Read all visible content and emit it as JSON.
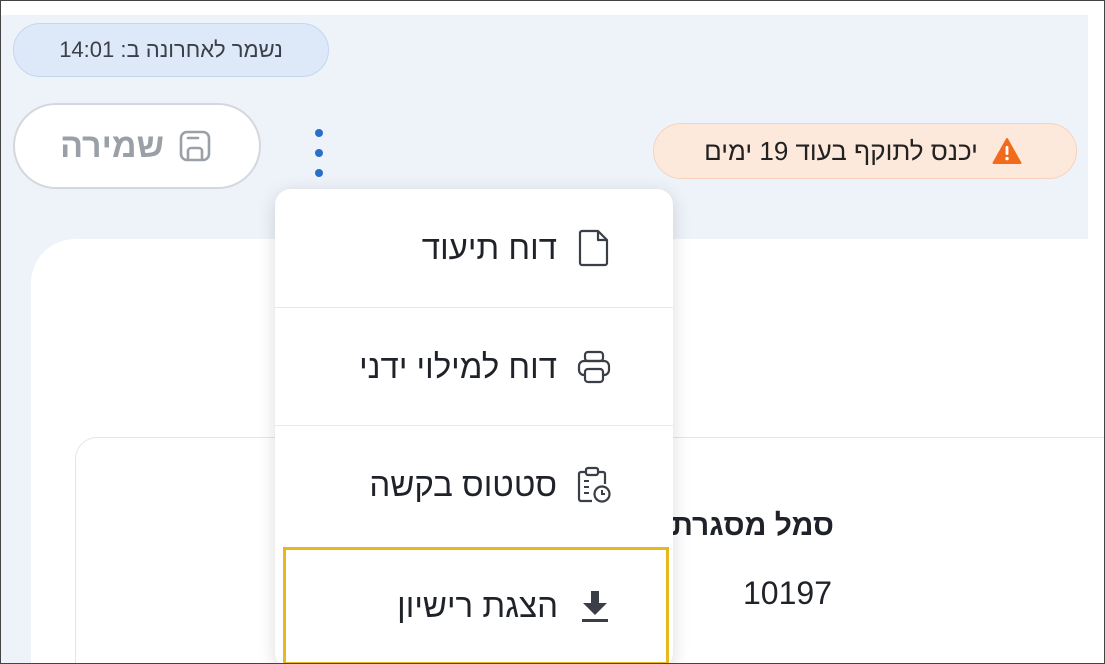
{
  "status": {
    "saved_text": "נשמר לאחרונה ב: 14:01"
  },
  "toolbar": {
    "save_label": "שמירה"
  },
  "warning": {
    "text": "יכנס לתוקף בעוד 19 ימים",
    "color": "#f26b1d"
  },
  "menu": {
    "items": [
      {
        "label": "דוח תיעוד",
        "icon": "document-icon"
      },
      {
        "label": "דוח למילוי ידני",
        "icon": "printer-icon"
      },
      {
        "label": "סטטוס בקשה",
        "icon": "clipboard-clock-icon"
      },
      {
        "label": "הצגת רישיון",
        "icon": "download-icon",
        "highlighted": true
      }
    ]
  },
  "field": {
    "label": "סמל מסגרת",
    "value": "10197"
  },
  "colors": {
    "accent": "#2a6fc9",
    "highlight": "#e8b820"
  }
}
